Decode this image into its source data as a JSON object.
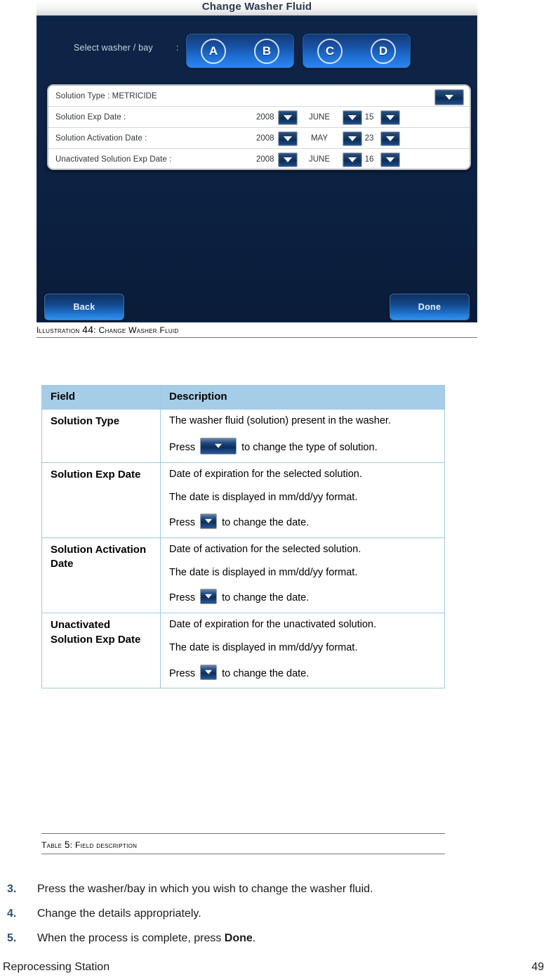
{
  "figure": {
    "window_title": "Change Washer Fluid",
    "bay_selector": {
      "label": "Select washer / bay",
      "colon": ":",
      "options": [
        "A",
        "B",
        "C",
        "D"
      ]
    },
    "form": {
      "solution_type": {
        "label": "Solution Type : METRICIDE",
        "dropdown_icon": "dropdown-caret-icon"
      },
      "rows": [
        {
          "label": "Solution Exp Date :",
          "year": "2008",
          "month": "JUNE",
          "day": "15"
        },
        {
          "label": "Solution Activation Date :",
          "year": "2008",
          "month": "MAY",
          "day": "23"
        },
        {
          "label": "Unactivated Solution Exp Date :",
          "year": "2008",
          "month": "JUNE",
          "day": "16"
        }
      ]
    },
    "buttons": {
      "back": "Back",
      "done": "Done"
    },
    "caption": {
      "prefix": "Illustration ",
      "number": "44",
      "separator": ": ",
      "text": "Change Washer Fluid"
    }
  },
  "field_table": {
    "headers": [
      "Field",
      "Description"
    ],
    "rows": [
      {
        "field": "Solution Type",
        "paragraphs": [
          {
            "text": "The washer fluid (solution) present in the washer."
          },
          {
            "before": "Press ",
            "icon": "dropdown-caret-icon",
            "icon_style": "wide",
            "after": " to change the type of solution."
          }
        ]
      },
      {
        "field": "Solution Exp Date",
        "paragraphs": [
          {
            "text": "Date of expiration for the selected solution."
          },
          {
            "text": "The date is displayed in mm/dd/yy format."
          },
          {
            "before": "Press ",
            "icon": "dropdown-caret-icon",
            "icon_style": "small",
            "after": " to change the date."
          }
        ]
      },
      {
        "field": "Solution Activation Date",
        "paragraphs": [
          {
            "text": "Date of activation for the selected solution."
          },
          {
            "text": "The date is displayed in mm/dd/yy format."
          },
          {
            "before": "Press ",
            "icon": "dropdown-caret-icon",
            "icon_style": "small",
            "after": " to change the date."
          }
        ]
      },
      {
        "field": "Unactivated Solution Exp Date",
        "paragraphs": [
          {
            "text": "Date of expiration for the unactivated solution."
          },
          {
            "text": "The date is displayed in mm/dd/yy format."
          },
          {
            "before": "Press ",
            "icon": "dropdown-caret-icon",
            "icon_style": "small",
            "after": " to change the date."
          }
        ]
      }
    ],
    "caption": {
      "prefix": "Table ",
      "number": "5",
      "separator": ": ",
      "text": "Field description"
    }
  },
  "steps": [
    {
      "number": "3.",
      "text": "Press the washer/bay in which you wish to change the washer fluid."
    },
    {
      "number": "4.",
      "text": "Change the details appropriately."
    },
    {
      "number": "5.",
      "before": "When the process is complete, press ",
      "bold": "Done",
      "after": "."
    }
  ],
  "footer": {
    "document_title": "Reprocessing Station",
    "page_number": "49"
  },
  "colors": {
    "screen_bg": "#0d2446",
    "bay_button": "#1f72d8",
    "table_header": "#a6cde8",
    "step_number": "#2b4f74"
  }
}
